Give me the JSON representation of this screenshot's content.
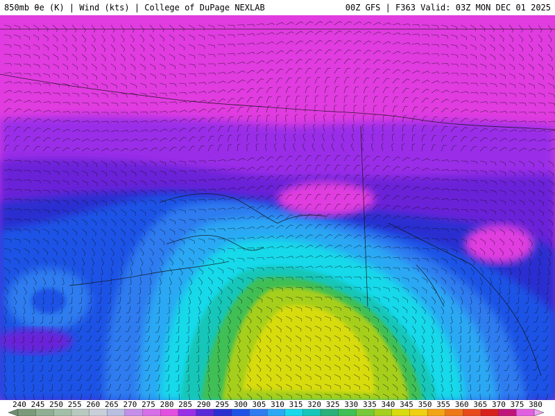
{
  "header": {
    "left": "850mb θe (K) | Wind (kts) | College of DuPage NEXLAB",
    "right": "00Z GFS | F363 Valid: 03Z MON DEC 01 2025"
  },
  "colors": {
    "magenta": "#e03ce0",
    "purple": "#9a2fe8",
    "violet": "#6a24d8",
    "blue_deep": "#2c2fd0",
    "blue": "#1d52e6",
    "blue_light": "#2e7cf0",
    "sky": "#2aa8f4",
    "cyan": "#18d9ea",
    "teal": "#16c6b8",
    "green": "#3fbf54",
    "lime": "#a6cf1e",
    "yellow": "#d8dc0e",
    "coast": "#111111"
  },
  "chart_data": {
    "type": "heatmap",
    "title": "850mb θe (K) | Wind (kts)",
    "colorbar": {
      "ticks": [
        "240",
        "245",
        "250",
        "255",
        "260",
        "265",
        "270",
        "275",
        "280",
        "285",
        "290",
        "295",
        "300",
        "305",
        "310",
        "315",
        "320",
        "325",
        "330",
        "335",
        "340",
        "345",
        "350",
        "355",
        "360",
        "365",
        "370",
        "375",
        "380"
      ],
      "range": [
        240,
        380
      ]
    }
  }
}
